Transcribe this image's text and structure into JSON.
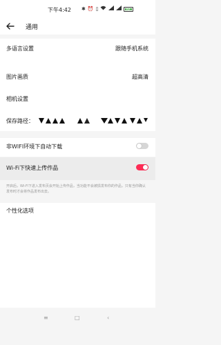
{
  "status_bar": {
    "time": "下午4:42",
    "icons": [
      "bluetooth-icon",
      "alarm-icon",
      "vibrate-icon",
      "wifi-icon",
      "signal-icon",
      "signal-icon",
      "battery-icon"
    ],
    "battery_level": "86"
  },
  "header": {
    "title": "通用"
  },
  "settings": {
    "language": {
      "label": "多语言设置",
      "value": "跟随手机系统"
    },
    "image_quality": {
      "label": "图片画质",
      "value": "超高清"
    },
    "camera": {
      "label": "相机设置"
    },
    "save_path": {
      "label": "保存路径："
    },
    "non_wifi_download": {
      "label": "非WIFI环境下自动下载",
      "enabled": false
    },
    "wifi_upload": {
      "label": "Wi-Fi下快速上传作品",
      "enabled": true
    },
    "wifi_upload_description": "开启后，Wi-Fi下进入发布页会开始上传作品，当功能不会被损发布你的作品，只有当你确认发布时才会将作品发布出去。",
    "personalization": {
      "label": "个性化选项"
    }
  },
  "colors": {
    "accent": "#fe2c55",
    "background": "#f5f5f5",
    "card": "#ffffff"
  }
}
